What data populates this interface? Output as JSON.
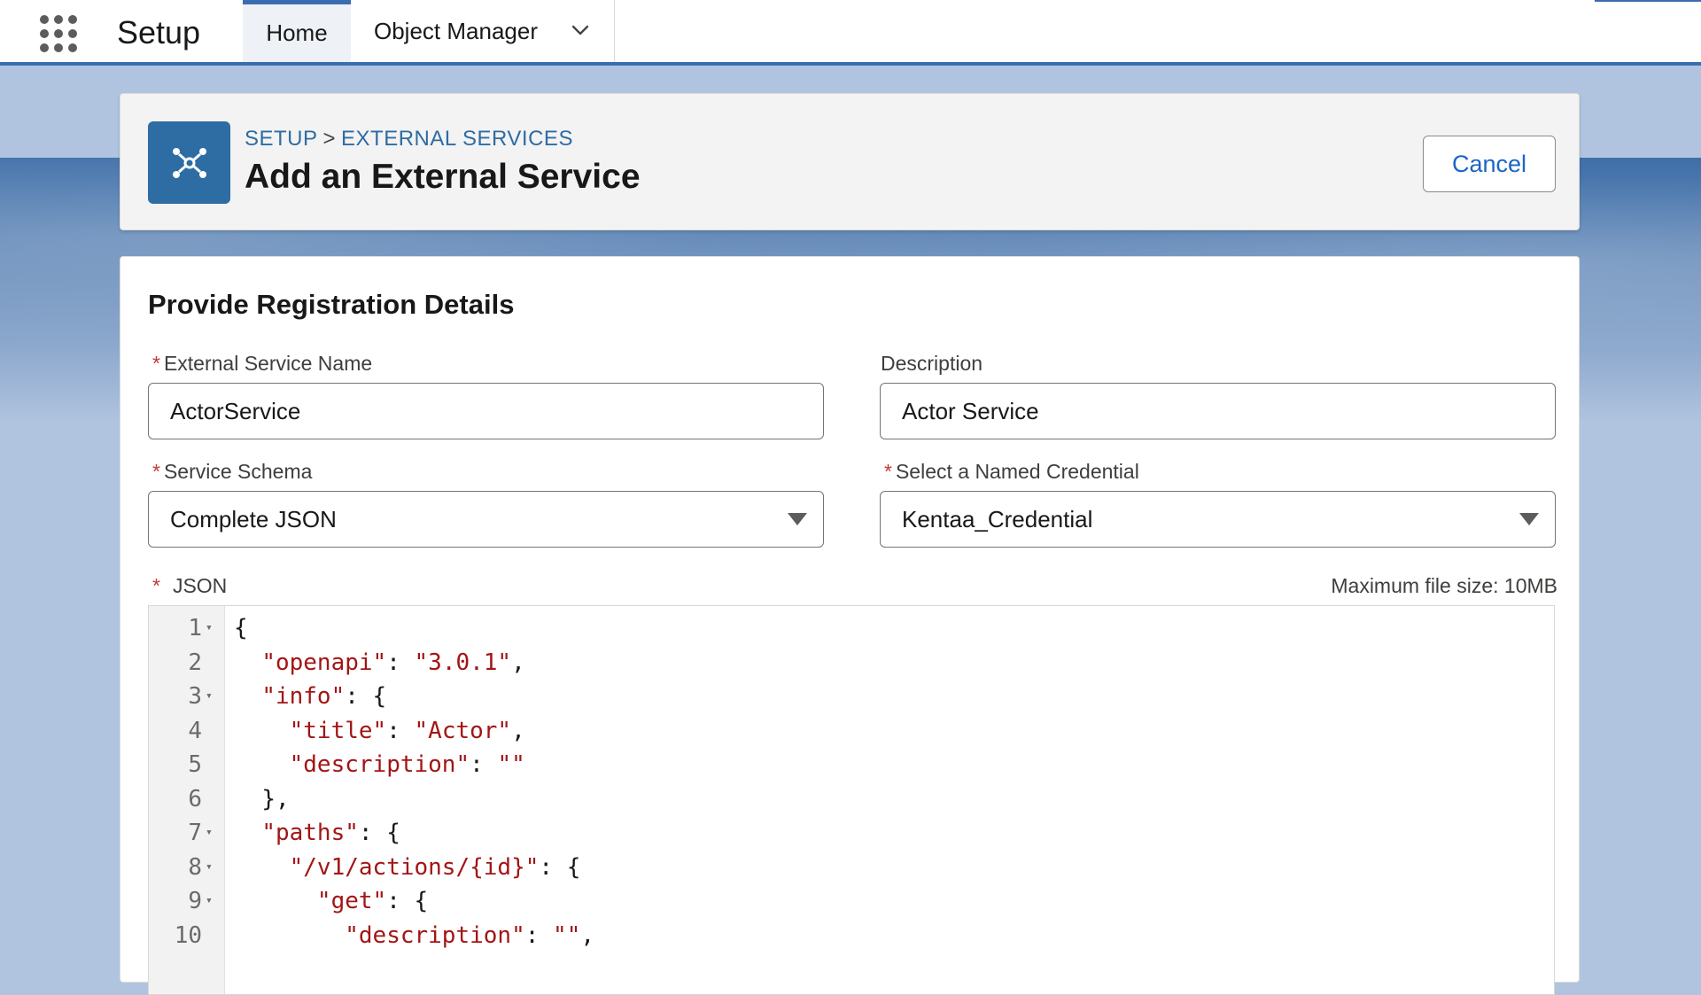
{
  "nav": {
    "app_name": "Setup",
    "tabs": [
      {
        "label": "Home"
      },
      {
        "label": "Object Manager"
      }
    ]
  },
  "header": {
    "breadcrumb": [
      "SETUP",
      "EXTERNAL SERVICES"
    ],
    "breadcrumb_separator": ">",
    "title": "Add an External Service",
    "cancel_label": "Cancel",
    "icon": "external-service-icon"
  },
  "form": {
    "section_title": "Provide Registration Details",
    "required_mark": "*",
    "service_name": {
      "label": "External Service Name",
      "value": "ActorService"
    },
    "description": {
      "label": "Description",
      "value": "Actor Service"
    },
    "service_schema": {
      "label": "Service Schema",
      "value": "Complete JSON"
    },
    "named_credential": {
      "label": "Select a Named Credential",
      "value": "Kentaa_Credential"
    },
    "json": {
      "label": "JSON",
      "max_size": "Maximum file size: 10MB"
    }
  },
  "editor": {
    "lines": [
      {
        "n": "1",
        "fold": true,
        "indent": "",
        "parts": [
          {
            "t": "p",
            "v": "{"
          }
        ]
      },
      {
        "n": "2",
        "fold": false,
        "indent": "  ",
        "parts": [
          {
            "t": "s",
            "v": "\"openapi\""
          },
          {
            "t": "p",
            "v": ": "
          },
          {
            "t": "s",
            "v": "\"3.0.1\""
          },
          {
            "t": "p",
            "v": ","
          }
        ]
      },
      {
        "n": "3",
        "fold": true,
        "indent": "  ",
        "parts": [
          {
            "t": "s",
            "v": "\"info\""
          },
          {
            "t": "p",
            "v": ": {"
          }
        ]
      },
      {
        "n": "4",
        "fold": false,
        "indent": "    ",
        "parts": [
          {
            "t": "s",
            "v": "\"title\""
          },
          {
            "t": "p",
            "v": ": "
          },
          {
            "t": "s",
            "v": "\"Actor\""
          },
          {
            "t": "p",
            "v": ","
          }
        ]
      },
      {
        "n": "5",
        "fold": false,
        "indent": "    ",
        "parts": [
          {
            "t": "s",
            "v": "\"description\""
          },
          {
            "t": "p",
            "v": ": "
          },
          {
            "t": "s",
            "v": "\"\""
          }
        ]
      },
      {
        "n": "6",
        "fold": false,
        "indent": "  ",
        "parts": [
          {
            "t": "p",
            "v": "},"
          }
        ]
      },
      {
        "n": "7",
        "fold": true,
        "indent": "  ",
        "parts": [
          {
            "t": "s",
            "v": "\"paths\""
          },
          {
            "t": "p",
            "v": ": {"
          }
        ]
      },
      {
        "n": "8",
        "fold": true,
        "indent": "    ",
        "parts": [
          {
            "t": "s",
            "v": "\"/v1/actions/{id}\""
          },
          {
            "t": "p",
            "v": ": {"
          }
        ]
      },
      {
        "n": "9",
        "fold": true,
        "indent": "      ",
        "parts": [
          {
            "t": "s",
            "v": "\"get\""
          },
          {
            "t": "p",
            "v": ": {"
          }
        ]
      },
      {
        "n": "10",
        "fold": false,
        "indent": "        ",
        "parts": [
          {
            "t": "s",
            "v": "\"description\""
          },
          {
            "t": "p",
            "v": ": "
          },
          {
            "t": "s",
            "v": "\"\""
          },
          {
            "t": "p",
            "v": ","
          }
        ]
      }
    ]
  }
}
